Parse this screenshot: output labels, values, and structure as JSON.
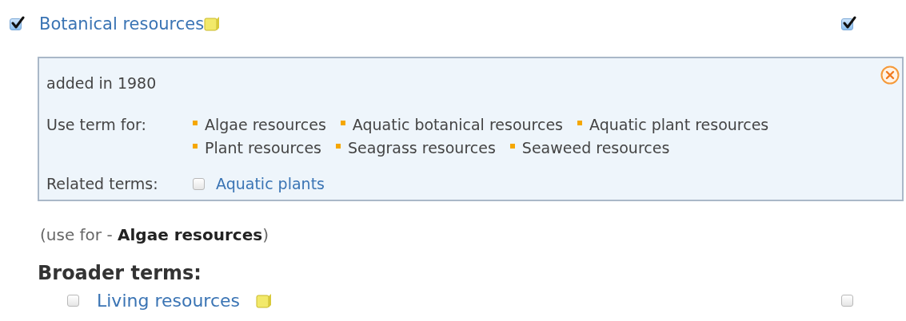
{
  "term": {
    "label": "Botanical resources",
    "checked": true,
    "column_checked": true
  },
  "details": {
    "note": "added in 1980",
    "use_for_label": "Use term for:",
    "use_for": [
      "Algae resources",
      "Aquatic botanical resources",
      "Aquatic plant resources",
      "Plant resources",
      "Seagrass resources",
      "Seaweed resources"
    ],
    "related_label": "Related terms:",
    "related": [
      {
        "label": "Aquatic plants",
        "checked": false
      }
    ]
  },
  "use_for_note": "(use for - **Algae resources**)",
  "broader": {
    "heading": "Broader terms:",
    "items": [
      {
        "label": "Living resources",
        "checked": false,
        "column_checked": false
      }
    ]
  }
}
